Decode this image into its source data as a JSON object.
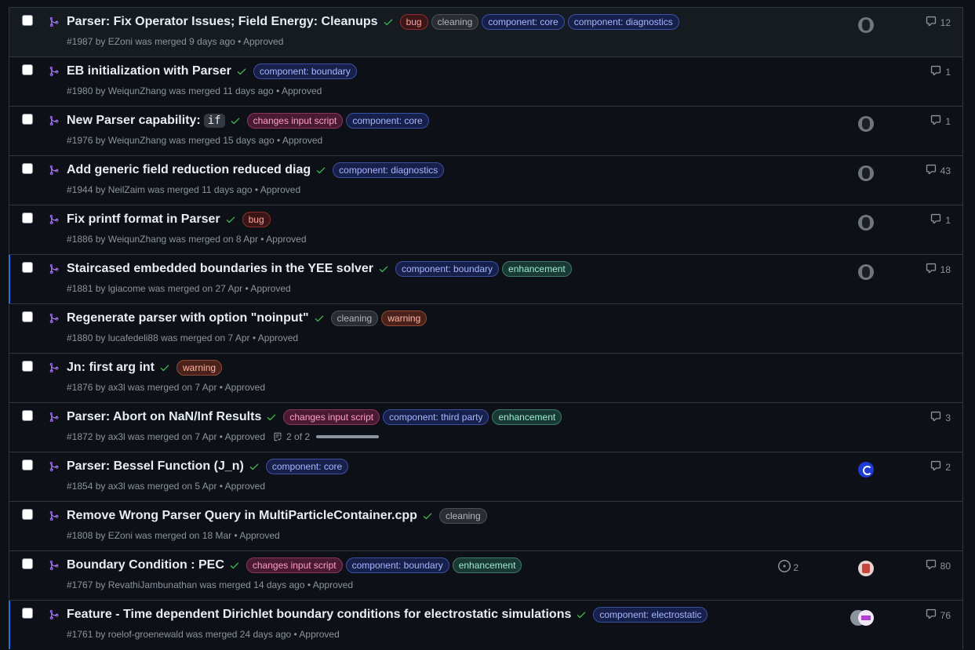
{
  "colors": {
    "bg": "#0d1117",
    "border": "#30363d",
    "pr_merged": "#a371f7",
    "check": "#3fb950",
    "muted": "#8b949e"
  },
  "pull_requests": [
    {
      "title": "Parser: Fix Operator Issues; Field Energy: Cleanups",
      "labels": [
        [
          "bug",
          "l-bug"
        ],
        [
          "cleaning",
          "l-cleaning"
        ],
        [
          "component: core",
          "l-core"
        ],
        [
          "component: diagnostics",
          "l-diagnostics"
        ]
      ],
      "meta": "#1987 by EZoni was merged 9 days ago • Approved",
      "avatar": "av-dark",
      "comments": "12",
      "highlight": true
    },
    {
      "title": "EB initialization with Parser",
      "labels": [
        [
          "component: boundary",
          "l-boundary"
        ]
      ],
      "meta": "#1980 by WeiqunZhang was merged 11 days ago • Approved",
      "avatar": "",
      "comments": "1"
    },
    {
      "title": "New Parser capability:",
      "code": "if",
      "labels": [
        [
          "changes input script",
          "l-changes"
        ],
        [
          "component: core",
          "l-core"
        ]
      ],
      "meta": "#1976 by WeiqunZhang was merged 15 days ago • Approved",
      "avatar": "av-dark",
      "comments": "1"
    },
    {
      "title": "Add generic field reduction reduced diag",
      "labels": [
        [
          "component: diagnostics",
          "l-diagnostics"
        ]
      ],
      "meta": "#1944 by NeilZaim was merged 11 days ago • Approved",
      "avatar": "av-dark",
      "comments": "43"
    },
    {
      "title": "Fix printf format in Parser",
      "labels": [
        [
          "bug",
          "l-bug"
        ]
      ],
      "meta": "#1886 by WeiqunZhang was merged on 8 Apr • Approved",
      "avatar": "av-dark",
      "comments": "1"
    },
    {
      "title": "Staircased embedded boundaries in the YEE solver",
      "labels": [
        [
          "component: boundary",
          "l-boundary"
        ],
        [
          "enhancement",
          "l-enh"
        ]
      ],
      "meta": "#1881 by lgiacome was merged on 27 Apr • Approved",
      "avatar": "av-dark",
      "comments": "18",
      "accent": true
    },
    {
      "title": "Regenerate parser with option \"noinput\"",
      "labels": [
        [
          "cleaning",
          "l-cleaning"
        ],
        [
          "warning",
          "l-warning"
        ]
      ],
      "meta": "#1880 by lucafedeli88 was merged on 7 Apr • Approved",
      "avatar": "",
      "comments": ""
    },
    {
      "title": "Jn: first arg int",
      "labels": [
        [
          "warning",
          "l-warning"
        ]
      ],
      "meta": "#1876 by ax3l was merged on 7 Apr • Approved",
      "avatar": "",
      "comments": ""
    },
    {
      "title": "Parser: Abort on NaN/Inf Results",
      "labels": [
        [
          "changes input script",
          "l-changes"
        ],
        [
          "component: third party",
          "l-third"
        ],
        [
          "enhancement",
          "l-enh"
        ]
      ],
      "meta": "#1872 by ax3l was merged on 7 Apr • Approved",
      "tasks": "2 of 2",
      "task_progress": 1.0,
      "avatar": "",
      "comments": "3"
    },
    {
      "title": "Parser: Bessel Function (J_n)",
      "labels": [
        [
          "component: core",
          "l-core"
        ]
      ],
      "meta": "#1854 by ax3l was merged on 5 Apr • Approved",
      "avatar": "av-blue",
      "comments": "2"
    },
    {
      "title": "Remove Wrong Parser Query in MultiParticleContainer.cpp",
      "labels": [
        [
          "cleaning",
          "l-cleaning"
        ]
      ],
      "meta": "#1808 by EZoni was merged on 18 Mar • Approved",
      "avatar": "",
      "comments": ""
    },
    {
      "title": "Boundary Condition : PEC",
      "labels": [
        [
          "changes input script",
          "l-changes"
        ],
        [
          "component: boundary",
          "l-boundary"
        ],
        [
          "enhancement",
          "l-enh"
        ]
      ],
      "meta": "#1767 by RevathiJambunathan was merged 14 days ago • Approved",
      "issues": "2",
      "avatar": "av-pink",
      "comments": "80"
    },
    {
      "title": "Feature - Time dependent Dirichlet boundary conditions for electrostatic simulations",
      "labels": [
        [
          "component: electrostatic",
          "l-electro"
        ]
      ],
      "meta": "#1761 by roelof-groenewald was merged 24 days ago • Approved",
      "avatar": "av-purple",
      "avatar2": "av-gray",
      "comments": "76",
      "accent": true
    }
  ]
}
